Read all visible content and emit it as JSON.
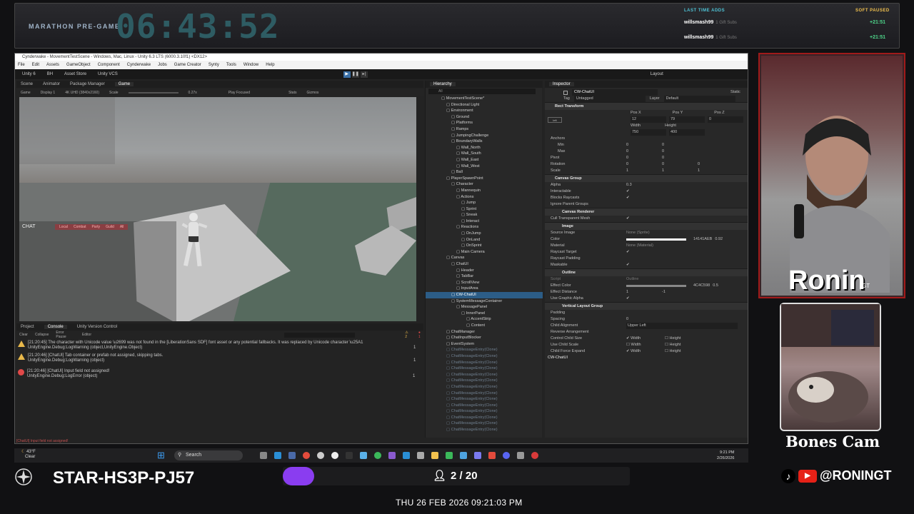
{
  "overlay": {
    "marathon_label": "MARATHON PRE-GAME",
    "timer": "06:43:52",
    "last_time_adds": "LAST TIME ADDS",
    "status": "SOFT PAUSED",
    "adds": [
      {
        "user": "willsmash99",
        "detail": "1 Gift Subs",
        "time": "+21:51"
      },
      {
        "user": "willsmash99",
        "detail": "1 Gift Subs",
        "time": "+21:51"
      }
    ]
  },
  "unity": {
    "title": "Cynderwake - MovementTestScene - Windows, Mac, Linux - Unity 6.3 LTS (6000.3.10f1) <DX12>",
    "menu": [
      "File",
      "Edit",
      "Assets",
      "GameObject",
      "Component",
      "Cynderwake",
      "Jobs",
      "Game Creator",
      "Synty",
      "Tools",
      "Window",
      "Help"
    ],
    "toolbar": {
      "unity": "Unity 6",
      "account": "BH",
      "store": "Asset Store",
      "vcs": "Unity VCS",
      "layout": "Layout"
    },
    "scene_tabs": [
      "Scene",
      "Animator",
      "Package Manager",
      "Game"
    ],
    "game_bar": {
      "mode": "Game",
      "display": "Display 1",
      "resolution": "4K UHD (3840x2160)",
      "scale_label": "Scale",
      "scale": "0.27x",
      "play_focused": "Play Focused",
      "stats": "Stats",
      "gizmos": "Gizmos"
    },
    "chat": {
      "title": "CHAT",
      "channels": [
        "Local",
        "Combat",
        "Party",
        "Guild",
        "All"
      ]
    },
    "console_tabs": [
      "Project",
      "Console",
      "Unity Version Control"
    ],
    "console_bar": {
      "clear": "Clear",
      "collapse": "Collapse",
      "error_pause": "Error Pause",
      "editor": "Editor",
      "warn_count": "2",
      "error_count": "1"
    },
    "logs": [
      {
        "type": "warn",
        "line1": "[21:20:45] The character with Unicode value \\u2699 was not found in the [LiberationSans SDF] font asset or any potential fallbacks. It was replaced by Unicode character \\u25A1",
        "line2": "UnityEngine.Debug:LogWarning (object,UnityEngine.Object)",
        "count": "1"
      },
      {
        "type": "warn",
        "line1": "[21:20:46] [ChatUI] Tab container or prefab not assigned, skipping tabs.",
        "line2": "UnityEngine.Debug:LogWarning (object)",
        "count": "1"
      },
      {
        "type": "error",
        "line1": "[21:20:46] [ChatUI] Input field not assigned!",
        "line2": "UnityEngine.Debug:LogError (object)",
        "count": "1"
      }
    ],
    "console_footer": "[ChatUI] Input field not assigned!",
    "hierarchy": {
      "title": "Hierarchy",
      "search": "All",
      "items": [
        {
          "label": "MovementTestScene*",
          "indent": 0
        },
        {
          "label": "Directional Light",
          "indent": 1
        },
        {
          "label": "Environment",
          "indent": 1
        },
        {
          "label": "Ground",
          "indent": 2
        },
        {
          "label": "Platforms",
          "indent": 2
        },
        {
          "label": "Ramps",
          "indent": 2
        },
        {
          "label": "JumpingChallenge",
          "indent": 2
        },
        {
          "label": "BoundaryWalls",
          "indent": 2
        },
        {
          "label": "Wall_North",
          "indent": 3
        },
        {
          "label": "Wall_South",
          "indent": 3
        },
        {
          "label": "Wall_East",
          "indent": 3
        },
        {
          "label": "Wall_West",
          "indent": 3
        },
        {
          "label": "Ball",
          "indent": 2
        },
        {
          "label": "PlayerSpawnPoint",
          "indent": 1
        },
        {
          "label": "Character",
          "indent": 2
        },
        {
          "label": "Mannequin",
          "indent": 3
        },
        {
          "label": "Actions",
          "indent": 3
        },
        {
          "label": "Jump",
          "indent": 4
        },
        {
          "label": "Sprint",
          "indent": 4
        },
        {
          "label": "Sneak",
          "indent": 4
        },
        {
          "label": "Interact",
          "indent": 4
        },
        {
          "label": "Reactions",
          "indent": 3
        },
        {
          "label": "OnJump",
          "indent": 4
        },
        {
          "label": "OnLand",
          "indent": 4
        },
        {
          "label": "OnSprint",
          "indent": 4
        },
        {
          "label": "Main Camera",
          "indent": 3
        },
        {
          "label": "Canvas",
          "indent": 1
        },
        {
          "label": "ChatUI",
          "indent": 2
        },
        {
          "label": "Header",
          "indent": 3
        },
        {
          "label": "TabBar",
          "indent": 3
        },
        {
          "label": "ScrollView",
          "indent": 3
        },
        {
          "label": "InputArea",
          "indent": 3
        },
        {
          "label": "CW-ChatUI",
          "indent": 2,
          "selected": true
        },
        {
          "label": "SystemMessageContainer",
          "indent": 2
        },
        {
          "label": "MessagePanel",
          "indent": 3
        },
        {
          "label": "InnerPanel",
          "indent": 4
        },
        {
          "label": "AccentStrip",
          "indent": 5
        },
        {
          "label": "Content",
          "indent": 5
        },
        {
          "label": "ChatManager",
          "indent": 1
        },
        {
          "label": "ChatInputBlocker",
          "indent": 1
        },
        {
          "label": "EventSystem",
          "indent": 1
        },
        {
          "label": "ChatMessageEntry(Clone)",
          "indent": 1,
          "dim": true
        },
        {
          "label": "ChatMessageEntry(Clone)",
          "indent": 1,
          "dim": true
        },
        {
          "label": "ChatMessageEntry(Clone)",
          "indent": 1,
          "dim": true
        },
        {
          "label": "ChatMessageEntry(Clone)",
          "indent": 1,
          "dim": true
        },
        {
          "label": "ChatMessageEntry(Clone)",
          "indent": 1,
          "dim": true
        },
        {
          "label": "ChatMessageEntry(Clone)",
          "indent": 1,
          "dim": true
        },
        {
          "label": "ChatMessageEntry(Clone)",
          "indent": 1,
          "dim": true
        },
        {
          "label": "ChatMessageEntry(Clone)",
          "indent": 1,
          "dim": true
        },
        {
          "label": "ChatMessageEntry(Clone)",
          "indent": 1,
          "dim": true
        },
        {
          "label": "ChatMessageEntry(Clone)",
          "indent": 1,
          "dim": true
        },
        {
          "label": "ChatMessageEntry(Clone)",
          "indent": 1,
          "dim": true
        },
        {
          "label": "ChatMessageEntry(Clone)",
          "indent": 1,
          "dim": true
        },
        {
          "label": "ChatMessageEntry(Clone)",
          "indent": 1,
          "dim": true
        },
        {
          "label": "ChatMessageEntry(Clone)",
          "indent": 1,
          "dim": true
        }
      ]
    },
    "inspector": {
      "title": "Inspector",
      "object_name": "CW-ChatUI",
      "static": "Static",
      "tag_label": "Tag",
      "tag": "Untagged",
      "layer_label": "Layer",
      "layer": "Default",
      "rect_transform": "Rect Transform",
      "stretch": "left",
      "pos_x_label": "Pos X",
      "pos_y_label": "Pos Y",
      "pos_z_label": "Pos Z",
      "pos_x": "12",
      "pos_y": "79",
      "pos_z": "0",
      "width_label": "Width",
      "height_label": "Height",
      "width": "750",
      "height": "400",
      "anchors": "Anchors",
      "min": "Min",
      "max": "Max",
      "pivot": "Pivot",
      "min_x": "0",
      "min_y": "0",
      "max_x": "0",
      "max_y": "0",
      "pivot_x": "0",
      "pivot_y": "0",
      "rotation": "Rotation",
      "rot_x": "0",
      "rot_y": "0",
      "rot_z": "0",
      "scale": "Scale",
      "scale_x": "1",
      "scale_y": "1",
      "scale_z": "1",
      "canvas_group": "Canvas Group",
      "alpha": "Alpha",
      "alpha_val": "0.3",
      "interactable": "Interactable",
      "blocks_raycasts": "Blocks Raycasts",
      "ignore_parent": "Ignore Parent Groups",
      "canvas_renderer": "Canvas Renderer",
      "cull": "Cull Transparent Mesh",
      "image": "Image",
      "source_image": "Source Image",
      "source_image_val": "None (Sprite)",
      "color": "Color",
      "color_val": "14141AEB",
      "color_alpha": "0.92",
      "material": "Material",
      "material_val": "None (Material)",
      "raycast_target": "Raycast Target",
      "raycast_padding": "Raycast Padding",
      "maskable": "Maskable",
      "outline": "Outline",
      "script": "Script",
      "script_val": "Outline",
      "effect_color": "Effect Color",
      "effect_color_val": "4C4C598",
      "effect_alpha": "0.5",
      "effect_distance": "Effect Distance",
      "ed_x": "1",
      "ed_y": "-1",
      "graphic_alpha": "Use Graphic Alpha",
      "vlg": "Vertical Layout Group",
      "padding": "Padding",
      "spacing": "Spacing",
      "spacing_val": "0",
      "child_alignment": "Child Alignment",
      "child_alignment_val": "Upper Left",
      "reverse": "Reverse Arrangement",
      "control_size": "Control Child Size",
      "use_scale": "Use Child Scale",
      "force_expand": "Child Force Expand",
      "width_w": "Width",
      "height_h": "Height",
      "footer": "CW-ChatUI"
    }
  },
  "taskbar": {
    "weather_temp": "43°F",
    "weather_desc": "Clear",
    "search": "Search",
    "time": "9:21 PM",
    "date": "2/26/2026"
  },
  "cam": {
    "logo": "Ronin",
    "logo_sup": "GT",
    "bones": "Bones Cam",
    "social": "@RONINGT"
  },
  "bottom": {
    "code": "STAR-HS3P-PJ57",
    "progress": 0.09,
    "progress_text": "2 / 20",
    "datetime": "THU 26 FEB 2026 09:21:03 PM"
  },
  "colors": {
    "accent": "#8a3df0",
    "timer": "#2e5c63",
    "selection": "#2c5d87",
    "warn": "#e8b84a",
    "error": "#e04848",
    "cam_border": "#a11a1a"
  }
}
